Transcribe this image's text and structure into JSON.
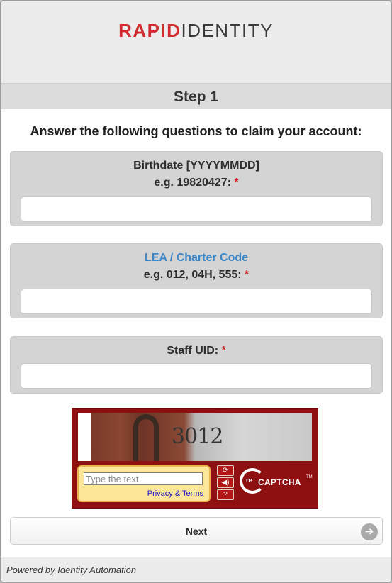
{
  "header": {
    "logo_bold": "RAPID",
    "logo_light": "IDENTITY"
  },
  "step": {
    "title": "Step 1"
  },
  "instructions": "Answer the following questions to claim your account:",
  "fields": [
    {
      "label": "Birthdate [YYYYMMDD]",
      "hint": "e.g. 19820427:",
      "required": "*",
      "value": ""
    },
    {
      "label": "LEA / Charter Code",
      "hint": "e.g. 012, 04H, 555:",
      "required": "*",
      "value": ""
    },
    {
      "label": "Staff UID:",
      "required": "*",
      "value": ""
    }
  ],
  "captcha": {
    "image_text": "3012",
    "input_placeholder": "Type the text",
    "privacy_link": "Privacy & Terms",
    "logo_re": "re",
    "logo_text": "CAPTCHA",
    "logo_tm": "TM",
    "buttons": [
      {
        "icon": "refresh-icon",
        "glyph": "⟳"
      },
      {
        "icon": "audio-icon",
        "glyph": "◀)"
      },
      {
        "icon": "help-icon",
        "glyph": "?"
      }
    ]
  },
  "next_button": {
    "label": "Next",
    "icon": "arrow-right-icon",
    "glyph": "➔"
  },
  "footer": {
    "text": "Powered by Identity Automation"
  },
  "colors": {
    "brand_red": "#d12a2f",
    "link_blue": "#3d86c6",
    "required_red": "#d0202a",
    "captcha_red": "#8f1010"
  }
}
